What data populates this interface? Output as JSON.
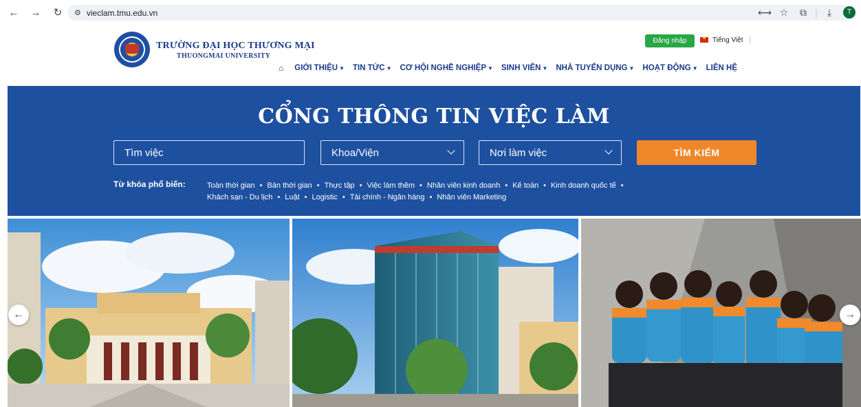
{
  "browser": {
    "url": "vieclam.tmu.edu.vn",
    "profile_initial": "T"
  },
  "header": {
    "brand_vn": "TRƯỜNG ĐẠI HỌC THƯƠNG MẠI",
    "brand_en": "THUONGMAI UNIVERSITY",
    "login_label": "Đăng nhập",
    "language_label": "Tiếng Việt",
    "nav": [
      {
        "label": "GIỚI THIỆU"
      },
      {
        "label": "TIN TỨC"
      },
      {
        "label": "CƠ HỘI NGHỀ NGHIỆP"
      },
      {
        "label": "SINH VIÊN"
      },
      {
        "label": "NHÀ TUYỂN DỤNG"
      },
      {
        "label": "HOẠT ĐỘNG"
      },
      {
        "label": "LIÊN HỆ"
      }
    ]
  },
  "hero": {
    "title": "CỔNG THÔNG TIN VIỆC LÀM",
    "job_placeholder": "Tìm việc",
    "faculty_selected": "Khoa/Viện",
    "location_selected": "Nơi làm việc",
    "search_label": "TÌM KIẾM",
    "keywords_label": "Từ khóa phổ biến:",
    "keywords": [
      "Toàn thời gian",
      "Bán thời gian",
      "Thực tập",
      "Việc làm thêm",
      "Nhân viên kinh doanh",
      "Kế toán",
      "Kinh doanh quốc tế",
      "Khách sạn - Du lịch",
      "Luật",
      "Logistic",
      "Tài chính - Ngân hàng",
      "Nhân viên Marketing"
    ]
  },
  "colors": {
    "brand_blue": "#1e50a0",
    "accent_orange": "#f0862a",
    "login_green": "#28a745",
    "nav_text": "#1a3a8a"
  }
}
